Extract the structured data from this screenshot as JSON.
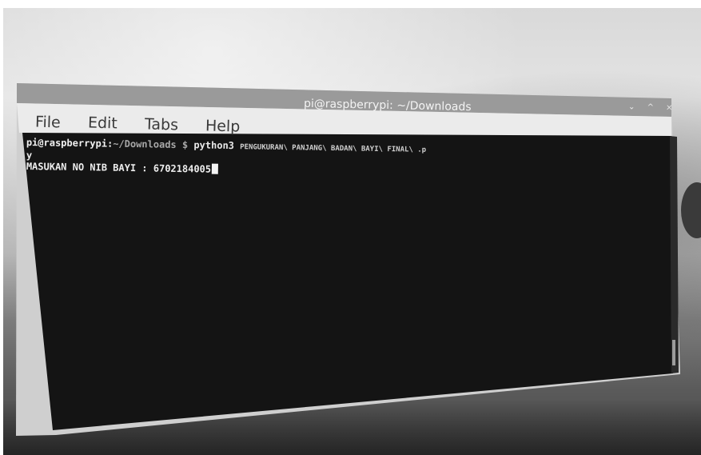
{
  "window": {
    "title": "pi@raspberrypi: ~/Downloads",
    "controls": "⌄ ^ ×"
  },
  "menubar": {
    "file": "File",
    "edit": "Edit",
    "tabs": "Tabs",
    "help": "Help"
  },
  "terminal": {
    "prompt_user": "pi@raspberrypi:",
    "prompt_path": "~/Downloads $",
    "command": "python3",
    "command_args": "PENGUKURAN\\ PANJANG\\ BADAN\\ BAYI\\ FINAL\\ .p",
    "command_wrap": "y",
    "output_label": "MASUKAN NO NIB BAYI : ",
    "output_value": "6702184005"
  },
  "colors": {
    "terminal_bg": "#141414",
    "titlebar": "#9a9a9a",
    "menubar": "#e6e6e6"
  }
}
